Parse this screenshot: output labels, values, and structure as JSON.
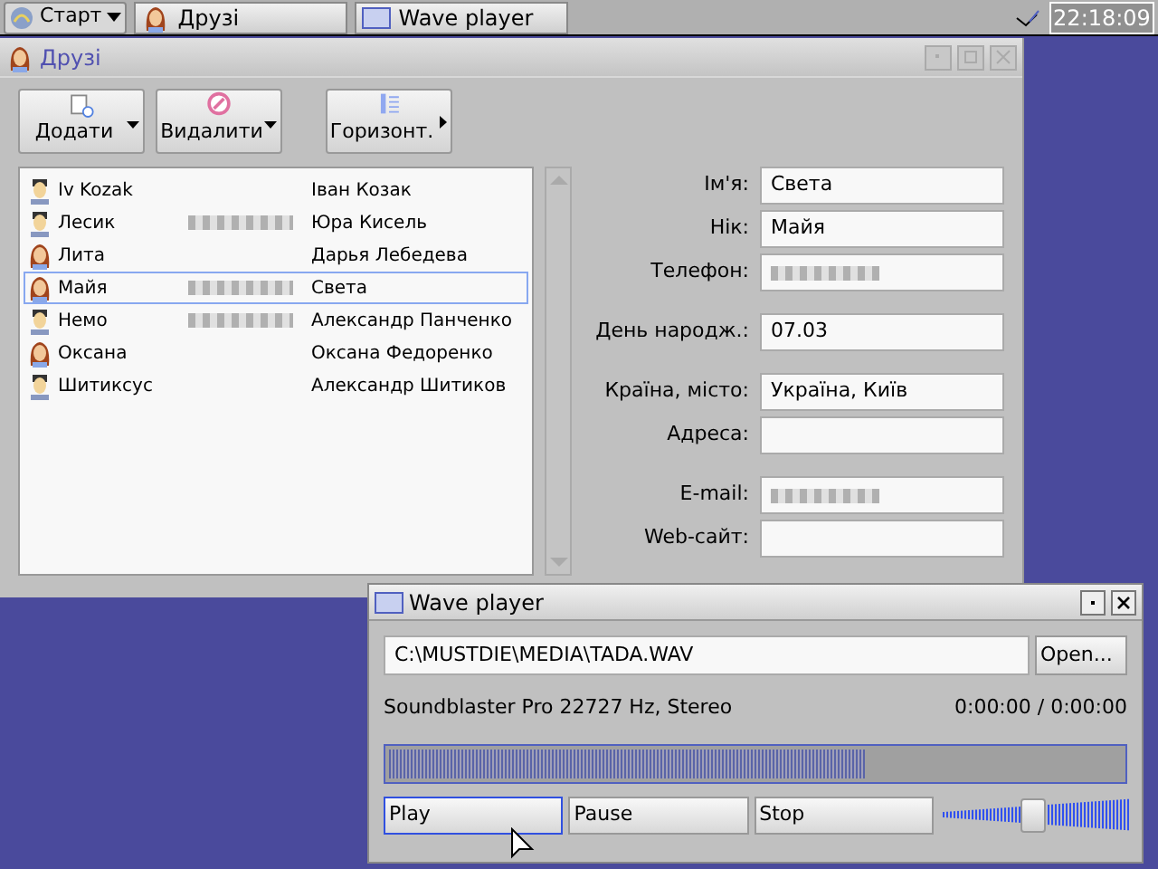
{
  "taskbar": {
    "start_label": "Старт",
    "tasks": [
      {
        "label": "Друзі"
      },
      {
        "label": "Wave player"
      }
    ],
    "clock": "22:18:09"
  },
  "contacts_window": {
    "title": "Друзі",
    "toolbar": [
      {
        "label": "Додати",
        "kind": "dropdown"
      },
      {
        "label": "Видалити",
        "kind": "dropdown"
      },
      {
        "label": "Горизонт.",
        "kind": "submenu"
      }
    ],
    "contacts": [
      {
        "nick": "Iv Kozak",
        "name": "Іван Козак",
        "kind": "male",
        "phone_redacted": false,
        "selected": false
      },
      {
        "nick": "Лесик",
        "name": "Юра Кисель",
        "kind": "male",
        "phone_redacted": true,
        "selected": false
      },
      {
        "nick": "Лита",
        "name": "Дарья Лебедева",
        "kind": "female",
        "phone_redacted": false,
        "selected": false
      },
      {
        "nick": "Майя",
        "name": "Света",
        "kind": "female",
        "phone_redacted": true,
        "selected": true
      },
      {
        "nick": "Немо",
        "name": "Александр Панченко",
        "kind": "male",
        "phone_redacted": true,
        "selected": false
      },
      {
        "nick": "Оксана",
        "name": "Оксана Федоренко",
        "kind": "female",
        "phone_redacted": false,
        "selected": false
      },
      {
        "nick": "Шитиксус",
        "name": "Александр Шитиков",
        "kind": "male",
        "phone_redacted": false,
        "selected": false
      }
    ],
    "detail_sections": [
      [
        {
          "label": "Ім'я:",
          "value": "Света"
        },
        {
          "label": "Нік:",
          "value": "Майя"
        },
        {
          "label": "Телефон:",
          "redacted": true
        }
      ],
      [
        {
          "label": "День народж.:",
          "value": "07.03"
        }
      ],
      [
        {
          "label": "Країна, місто:",
          "value": "Україна, Київ"
        },
        {
          "label": "Адреса:"
        }
      ],
      [
        {
          "label": "E-mail:",
          "redacted": true
        },
        {
          "label": "Web-сайт:"
        }
      ]
    ]
  },
  "wave_player": {
    "title": "Wave player",
    "path": "C:\\MUSTDIE\\MEDIA\\TADA.WAV",
    "open_button": "Open...",
    "info": "Soundblaster Pro 22727 Hz, Stereo",
    "time": "0:00:00 / 0:00:00",
    "progress": {
      "level": 0.65
    },
    "buttons": [
      {
        "label": "Play",
        "selected": true
      },
      {
        "label": "Pause",
        "selected": false
      },
      {
        "label": "Stop",
        "selected": false
      }
    ],
    "volume": {
      "level": 0.48
    }
  }
}
